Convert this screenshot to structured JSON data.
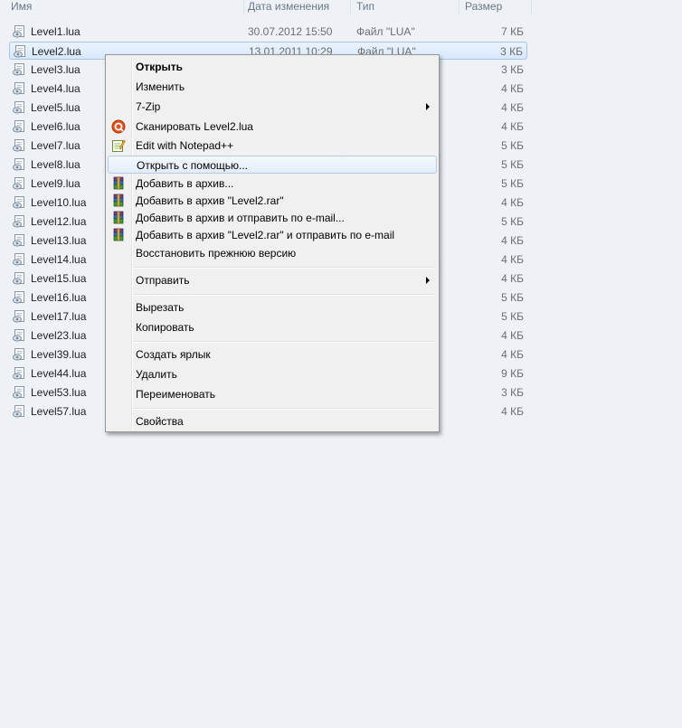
{
  "columns": {
    "name": "Имя",
    "date": "Дата изменения",
    "type": "Тип",
    "size": "Размер"
  },
  "files": [
    {
      "name": "Level1.lua",
      "date": "30.07.2012 15:50",
      "type": "Файл \"LUA\"",
      "size": "7 КБ"
    },
    {
      "name": "Level2.lua",
      "date": "13.01.2011 10:29",
      "type": "Файл \"LUA\"",
      "size": "3 КБ",
      "selected": true
    },
    {
      "name": "Level3.lua",
      "size": "3 КБ"
    },
    {
      "name": "Level4.lua",
      "size": "4 КБ"
    },
    {
      "name": "Level5.lua",
      "size": "4 КБ"
    },
    {
      "name": "Level6.lua",
      "size": "4 КБ"
    },
    {
      "name": "Level7.lua",
      "size": "5 КБ"
    },
    {
      "name": "Level8.lua",
      "size": "5 КБ"
    },
    {
      "name": "Level9.lua",
      "size": "5 КБ"
    },
    {
      "name": "Level10.lua",
      "size": "4 КБ"
    },
    {
      "name": "Level12.lua",
      "size": "5 КБ"
    },
    {
      "name": "Level13.lua",
      "size": "4 КБ"
    },
    {
      "name": "Level14.lua",
      "size": "4 КБ"
    },
    {
      "name": "Level15.lua",
      "size": "4 КБ"
    },
    {
      "name": "Level16.lua",
      "size": "5 КБ"
    },
    {
      "name": "Level17.lua",
      "size": "5 КБ"
    },
    {
      "name": "Level23.lua",
      "size": "4 КБ"
    },
    {
      "name": "Level39.lua",
      "size": "4 КБ"
    },
    {
      "name": "Level44.lua",
      "size": "9 КБ"
    },
    {
      "name": "Level53.lua",
      "size": "3 КБ"
    },
    {
      "name": "Level57.lua",
      "size": "4 КБ"
    }
  ],
  "context_menu": {
    "open": "Открыть",
    "edit": "Изменить",
    "sevenzip": "7-Zip",
    "scan": "Сканировать Level2.lua",
    "notepad": "Edit with Notepad++",
    "open_with": "Открыть с помощью...",
    "add_archive": "Добавить в архив...",
    "add_rar": "Добавить в архив \"Level2.rar\"",
    "add_email": "Добавить в архив и отправить по e-mail...",
    "add_rar_email": "Добавить в архив \"Level2.rar\" и отправить по e-mail",
    "restore": "Восстановить прежнюю версию",
    "send_to": "Отправить",
    "cut": "Вырезать",
    "copy": "Копировать",
    "shortcut": "Создать ярлык",
    "delete": "Удалить",
    "rename": "Переименовать",
    "properties": "Свойства"
  },
  "icons": {
    "file": "lua-file-icon",
    "scan": "antivirus-scan-icon",
    "notepad": "notepad-plus-plus-icon",
    "rar": "winrar-archive-icon"
  },
  "colors": {
    "background": "#eef2f7",
    "menu_bg": "#f0f0f0",
    "selection_border": "#a6c6ec",
    "secondary_text": "#6d6d6d"
  }
}
